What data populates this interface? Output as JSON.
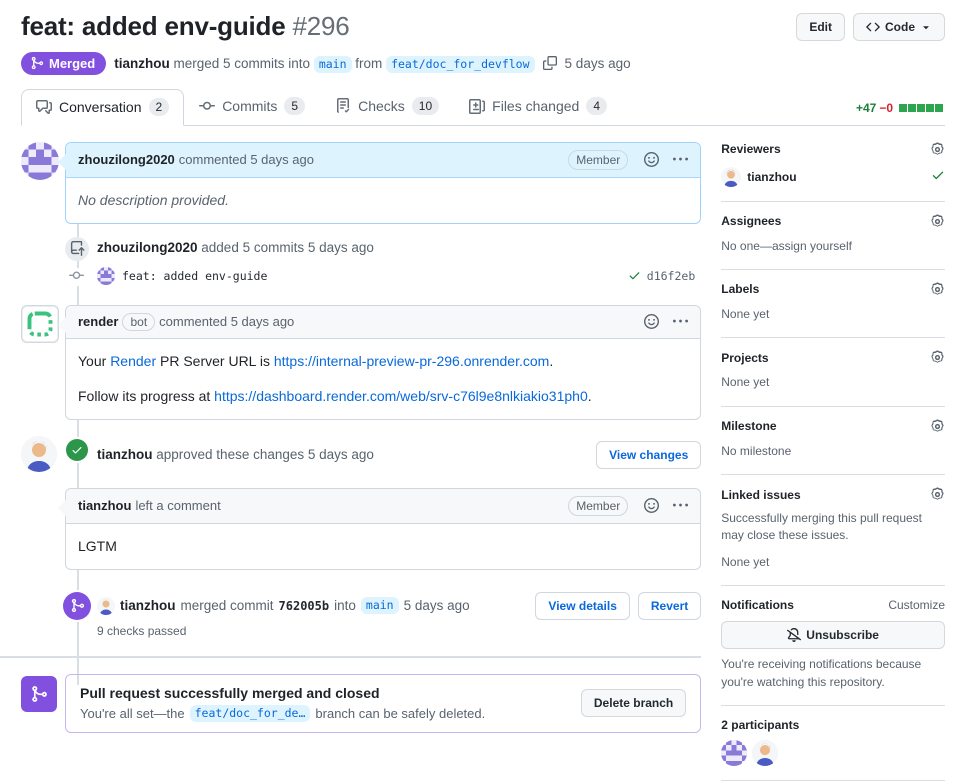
{
  "header": {
    "title": "feat: added env-guide",
    "number": "#296",
    "edit_button": "Edit",
    "code_button": "Code",
    "state_badge": "Merged",
    "author": "tianzhou",
    "summary_action": "merged 5 commits into",
    "base_branch": "main",
    "from_label": "from",
    "head_branch": "feat/doc_for_devflow",
    "merged_time": "5 days ago"
  },
  "tabs": {
    "conversation": {
      "label": "Conversation",
      "count": "2"
    },
    "commits": {
      "label": "Commits",
      "count": "5"
    },
    "checks": {
      "label": "Checks",
      "count": "10"
    },
    "files": {
      "label": "Files changed",
      "count": "4"
    },
    "diff_additions": "+47",
    "diff_deletions": "−0"
  },
  "timeline": {
    "description_comment": {
      "author": "zhouzilong2020",
      "meta": "commented 5 days ago",
      "member_badge": "Member",
      "body": "No description provided."
    },
    "commits_event": {
      "author": "zhouzilong2020",
      "text": "added 5 commits 5 days ago"
    },
    "commit_row": {
      "message": "feat: added env-guide",
      "sha": "d16f2eb"
    },
    "render_comment": {
      "author": "render",
      "bot_badge": "bot",
      "meta": "commented 5 days ago",
      "line1_pre": "Your ",
      "line1_link1": "Render",
      "line1_mid": " PR Server URL is ",
      "line1_link2": "https://internal-preview-pr-296.onrender.com",
      "line1_post": ".",
      "line2_pre": "Follow its progress at ",
      "line2_link": "https://dashboard.render.com/web/srv-c76l9e8nlkiakio31ph0",
      "line2_post": "."
    },
    "approval_event": {
      "author": "tianzhou",
      "text": "approved these changes 5 days ago",
      "button": "View changes"
    },
    "review_comment": {
      "author": "tianzhou",
      "meta": "left a comment",
      "member_badge": "Member",
      "body": "LGTM"
    },
    "merge_event": {
      "author": "tianzhou",
      "action": "merged commit",
      "sha": "762005b",
      "into_label": "into",
      "branch": "main",
      "time": "5 days ago",
      "checks": "9 checks passed",
      "details_button": "View details",
      "revert_button": "Revert"
    },
    "merged_banner": {
      "title": "Pull request successfully merged and closed",
      "sub_pre": "You're all set—the",
      "branch": "feat/doc_for_de…",
      "sub_post": "branch can be safely deleted.",
      "delete_button": "Delete branch"
    }
  },
  "sidebar": {
    "reviewers": {
      "title": "Reviewers",
      "name": "tianzhou"
    },
    "assignees": {
      "title": "Assignees",
      "empty": "No one—assign yourself"
    },
    "labels": {
      "title": "Labels",
      "empty": "None yet"
    },
    "projects": {
      "title": "Projects",
      "empty": "None yet"
    },
    "milestone": {
      "title": "Milestone",
      "empty": "No milestone"
    },
    "linked_issues": {
      "title": "Linked issues",
      "desc": "Successfully merging this pull request may close these issues.",
      "empty": "None yet"
    },
    "notifications": {
      "title": "Notifications",
      "customize": "Customize",
      "button": "Unsubscribe",
      "desc": "You're receiving notifications because you're watching this repository."
    },
    "participants": {
      "title": "2 participants"
    }
  },
  "colors": {
    "merged_purple": "#8250df",
    "link_blue": "#0969da",
    "success_green": "#2da44e",
    "danger_red": "#d1242f",
    "author_highlight": "#ddf4ff"
  }
}
